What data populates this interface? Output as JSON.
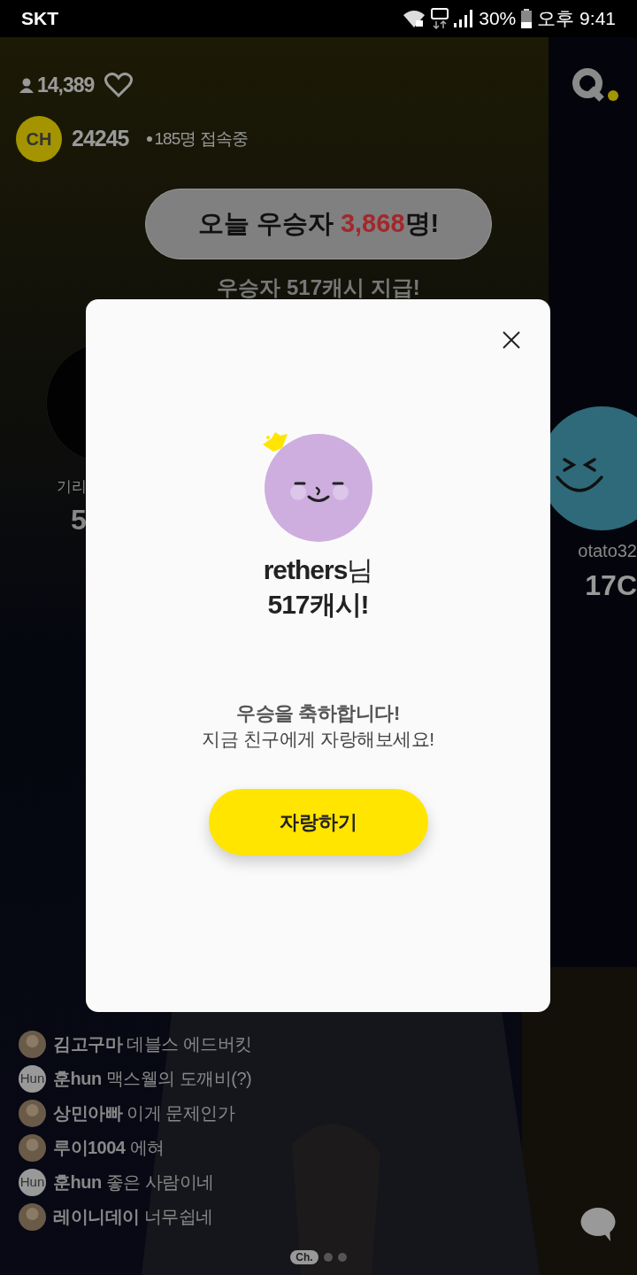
{
  "status_bar": {
    "carrier": "SKT",
    "battery": "30%",
    "time": "오후 9:41"
  },
  "header": {
    "viewers": "14,389",
    "channel_badge": "CH",
    "channel_number": "24245",
    "online": "185명 접속중"
  },
  "winners_banner": {
    "prefix": "오늘 우승자 ",
    "count": "3,868",
    "suffix": "명!"
  },
  "prize_caption": "우승자 517캐시 지급!",
  "winner_cards": [
    {
      "name": "기리",
      "amount": "5",
      "kind": "left"
    },
    {
      "name": "otato32",
      "amount": "17C",
      "kind": "right"
    }
  ],
  "chat": [
    {
      "user": "김고구마",
      "message": "데블스 에드버킷"
    },
    {
      "user": "훈hun",
      "message": "맥스웰의 도깨비(?)",
      "kind": "text",
      "avatar_text": "Hun"
    },
    {
      "user": "상민아빠",
      "message": "이게 문제인가"
    },
    {
      "user": "루이1004",
      "message": "에혀"
    },
    {
      "user": "훈hun",
      "message": "좋은 사람이네",
      "kind": "text",
      "avatar_text": "Hun"
    },
    {
      "user": "레이니데이",
      "message": "너무쉽네"
    }
  ],
  "pager": [
    {
      "label": "Ch.",
      "selected": true
    },
    {
      "selected": false
    },
    {
      "selected": false
    }
  ],
  "dialog": {
    "name": "rethers",
    "name_suffix": "님",
    "prize": "517캐시!",
    "message_title": "우승을 축하합니다!",
    "message_body": "지금 친구에게 자랑해보세요!",
    "button": "자랑하기"
  }
}
